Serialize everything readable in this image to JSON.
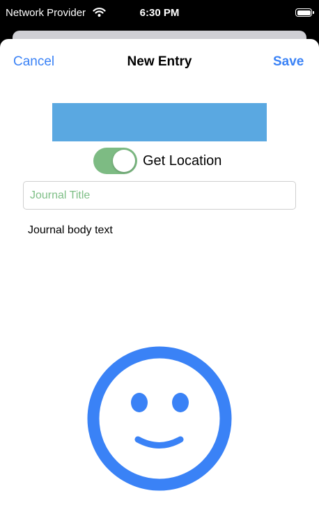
{
  "status_bar": {
    "carrier": "Network Provider",
    "time": "6:30 PM",
    "wifi_icon": "wifi-icon",
    "battery_icon": "battery-icon"
  },
  "nav": {
    "cancel_label": "Cancel",
    "title": "New Entry",
    "save_label": "Save"
  },
  "colors": {
    "accent": "#3a82f6",
    "color_block": "#5aa8e1",
    "toggle_on": "#7dbb83"
  },
  "location_toggle": {
    "label": "Get Location",
    "on": true
  },
  "title_field": {
    "value": "",
    "placeholder": "Journal Title"
  },
  "body": {
    "text": "Journal body text"
  },
  "mood": {
    "icon": "smiley-face-icon"
  }
}
